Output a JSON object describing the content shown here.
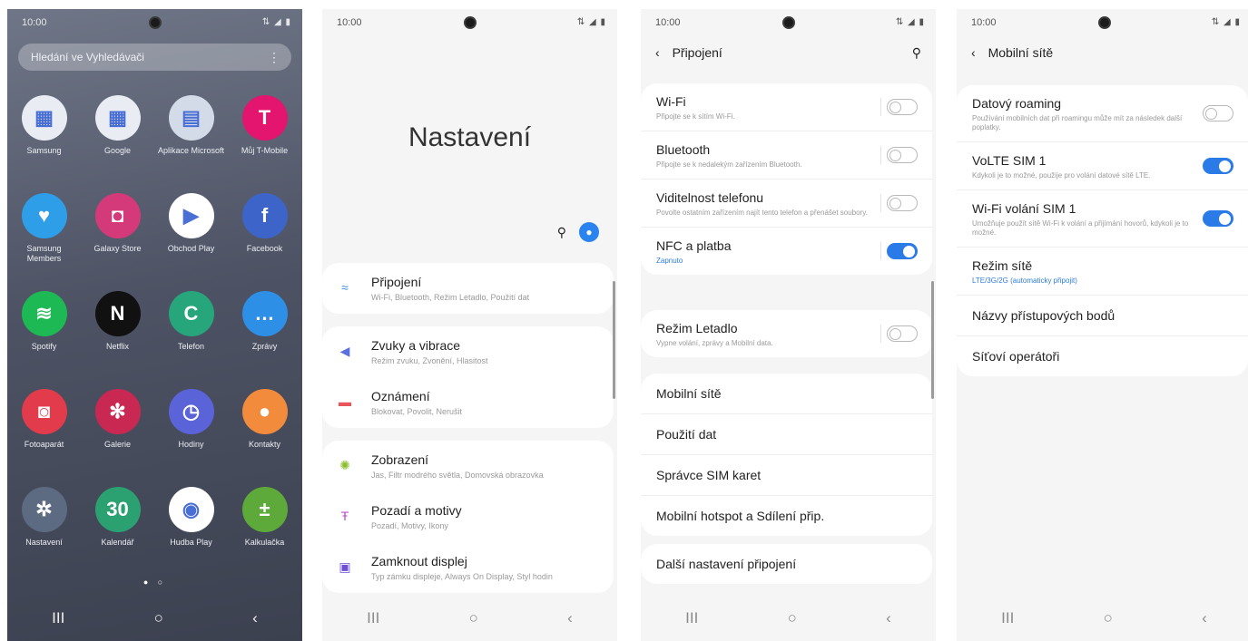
{
  "status": {
    "time": "10:00",
    "signal": "⇅ ◢ ▮"
  },
  "nav": {
    "recent": "III",
    "home": "○",
    "back": "‹"
  },
  "home": {
    "search_placeholder": "Hledání ve Vyhledávači",
    "more": "⋮",
    "apps": [
      {
        "label": "Samsung",
        "icon": "samsung-folder-icon",
        "glyph": "▦",
        "color": "#e9ecf3"
      },
      {
        "label": "Google",
        "icon": "google-folder-icon",
        "glyph": "▦",
        "color": "#e9ecf3"
      },
      {
        "label": "Aplikace Microsoft",
        "icon": "microsoft-folder-icon",
        "glyph": "▤",
        "color": "#d4dbe8"
      },
      {
        "label": "Můj T-Mobile",
        "icon": "t-mobile-icon",
        "glyph": "T",
        "color": "#e3156f"
      },
      {
        "label": "Samsung Members",
        "icon": "members-icon",
        "glyph": "♥",
        "color": "#2f9ee8"
      },
      {
        "label": "Galaxy Store",
        "icon": "galaxy-store-icon",
        "glyph": "◘",
        "color": "#d43a7a"
      },
      {
        "label": "Obchod Play",
        "icon": "play-store-icon",
        "glyph": "▶",
        "color": "#ffffff"
      },
      {
        "label": "Facebook",
        "icon": "facebook-icon",
        "glyph": "f",
        "color": "#3d65c9"
      },
      {
        "label": "Spotify",
        "icon": "spotify-icon",
        "glyph": "≋",
        "color": "#1db954"
      },
      {
        "label": "Netflix",
        "icon": "netflix-icon",
        "glyph": "N",
        "color": "#111111"
      },
      {
        "label": "Telefon",
        "icon": "phone-icon",
        "glyph": "C",
        "color": "#27a57b"
      },
      {
        "label": "Zprávy",
        "icon": "messages-icon",
        "glyph": "…",
        "color": "#2d8fe6"
      },
      {
        "label": "Fotoaparát",
        "icon": "camera-icon",
        "glyph": "◙",
        "color": "#e23c4c"
      },
      {
        "label": "Galerie",
        "icon": "gallery-icon",
        "glyph": "✻",
        "color": "#c92852"
      },
      {
        "label": "Hodiny",
        "icon": "clock-icon",
        "glyph": "◷",
        "color": "#5b63d8"
      },
      {
        "label": "Kontakty",
        "icon": "contacts-icon",
        "glyph": "●",
        "color": "#f28b3c"
      },
      {
        "label": "Nastavení",
        "icon": "settings-icon",
        "glyph": "✲",
        "color": "#5c6b82"
      },
      {
        "label": "Kalendář",
        "icon": "calendar-icon",
        "glyph": "30",
        "color": "#2ba172"
      },
      {
        "label": "Hudba Play",
        "icon": "play-music-icon",
        "glyph": "◉",
        "color": "#ffffff"
      },
      {
        "label": "Kalkulačka",
        "icon": "calculator-icon",
        "glyph": "±",
        "color": "#5daa3a"
      }
    ],
    "page_dots": "● ○"
  },
  "settings": {
    "title": "Nastavení",
    "search_icon": "⚲",
    "profile_icon": "●",
    "items": [
      {
        "title": "Připojení",
        "sub": "Wi-Fi, Bluetooth, Režim Letadlo, Použití dat",
        "icon": "wifi-icon",
        "glyph": "≈",
        "color": "#3a8ee6"
      },
      {
        "title": "Zvuky a vibrace",
        "sub": "Režim zvuku, Zvonění, Hlasitost",
        "icon": "sound-icon",
        "glyph": "◀",
        "color": "#5b6fe0"
      },
      {
        "title": "Oznámení",
        "sub": "Blokovat, Povolit, Nerušit",
        "icon": "notifications-icon",
        "glyph": "▬",
        "color": "#e8545a"
      },
      {
        "title": "Zobrazení",
        "sub": "Jas, Filtr modrého světla, Domovská obrazovka",
        "icon": "display-icon",
        "glyph": "✺",
        "color": "#8bbf2e"
      },
      {
        "title": "Pozadí a motivy",
        "sub": "Pozadí, Motivy, Ikony",
        "icon": "themes-icon",
        "glyph": "Ŧ",
        "color": "#b44fc7"
      },
      {
        "title": "Zamknout displej",
        "sub": "Typ zámku displeje, Always On Display, Styl hodin",
        "icon": "lock-screen-icon",
        "glyph": "▣",
        "color": "#6f4fd6"
      }
    ]
  },
  "connections": {
    "back": "‹",
    "title": "Připojení",
    "search_icon": "⚲",
    "group1": [
      {
        "title": "Wi-Fi",
        "sub": "Připojte se k sítím Wi-Fi.",
        "on": false
      },
      {
        "title": "Bluetooth",
        "sub": "Připojte se k nedalekým zařízením Bluetooth.",
        "on": false
      },
      {
        "title": "Viditelnost telefonu",
        "sub": "Povolte ostatním zařízením najít tento telefon a přenášet soubory.",
        "on": false
      },
      {
        "title": "NFC a platba",
        "sub": "Zapnuto",
        "on": true
      }
    ],
    "group2": [
      {
        "title": "Režim Letadlo",
        "sub": "Vypne volání, zprávy a Mobilní data.",
        "on": false
      }
    ],
    "group3": [
      "Mobilní sítě",
      "Použití dat",
      "Správce SIM karet",
      "Mobilní hotspot a Sdílení přip."
    ],
    "group4": [
      "Další nastavení připojení"
    ]
  },
  "mobile": {
    "back": "‹",
    "title": "Mobilní sítě",
    "toggles": [
      {
        "title": "Datový roaming",
        "sub": "Používání mobilních dat při roamingu může mít za následek další poplatky.",
        "on": false
      },
      {
        "title": "VoLTE SIM 1",
        "sub": "Kdykoli je to možné, použije pro volání datové sítě LTE.",
        "on": true
      },
      {
        "title": "Wi-Fi volání SIM 1",
        "sub": "Umožňuje použít sítě Wi-Fi k volání a přijímání hovorů, kdykoli je to možné.",
        "on": true
      }
    ],
    "mode": {
      "title": "Režim sítě",
      "sub": "LTE/3G/2G (automaticky připojit)"
    },
    "items": [
      "Názvy přístupových bodů",
      "Síťoví operátoři"
    ]
  }
}
